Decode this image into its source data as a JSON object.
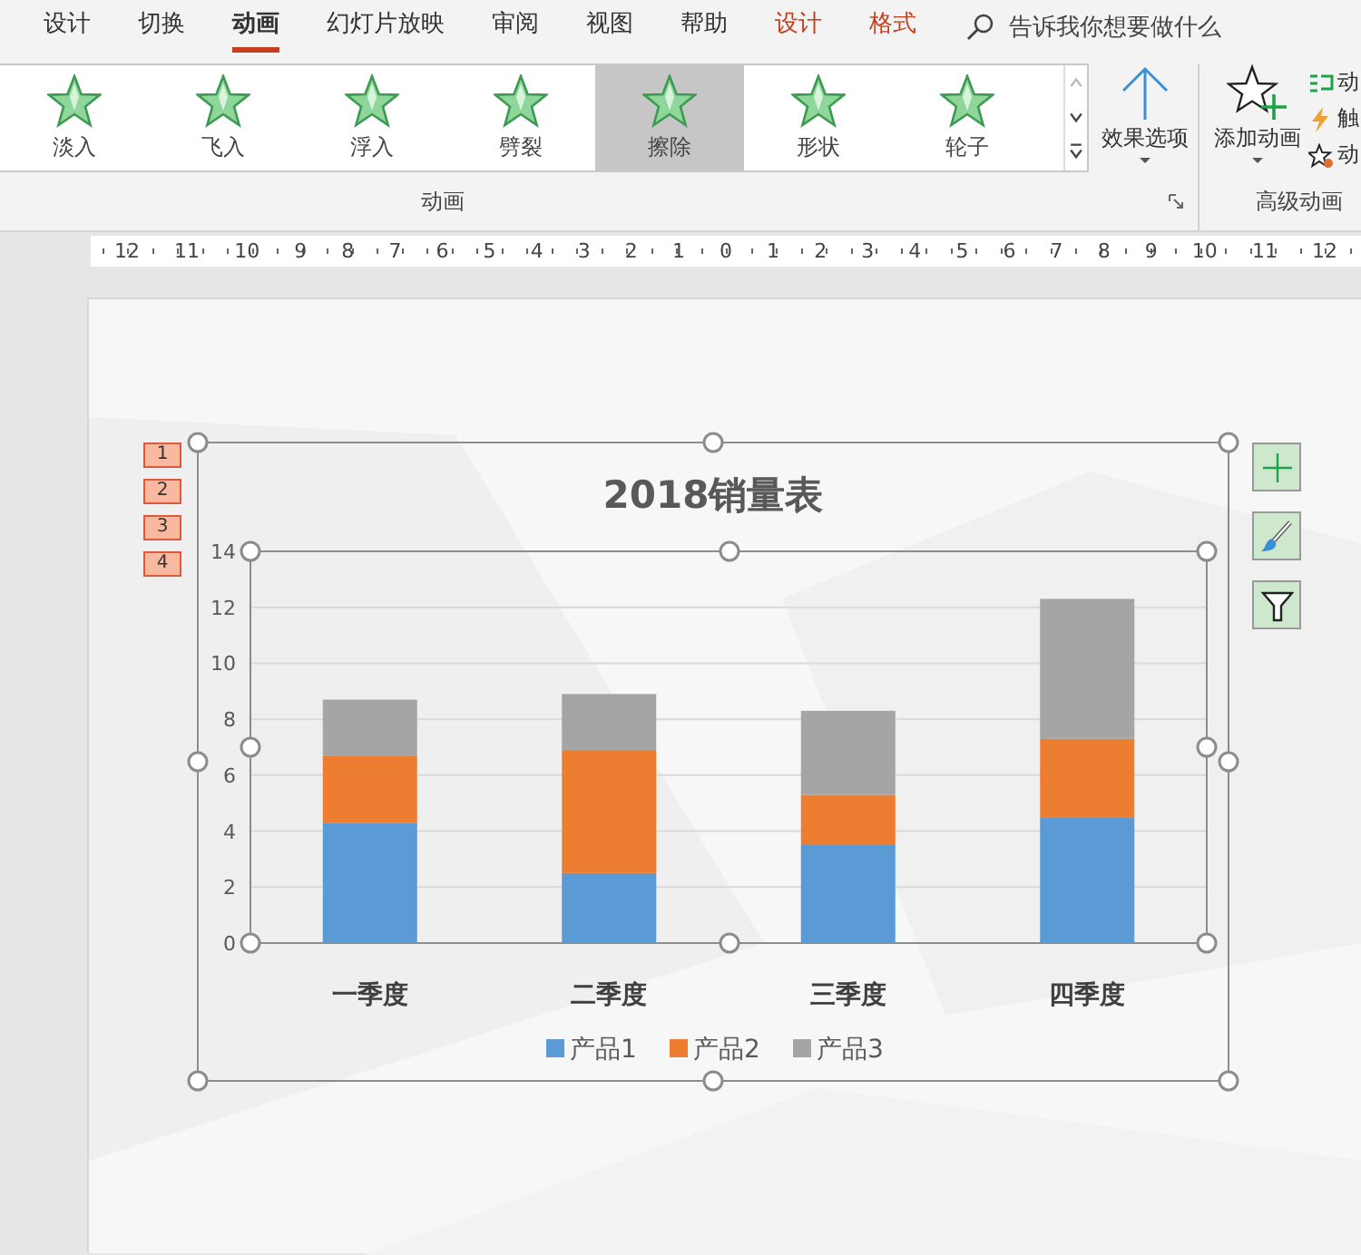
{
  "ribbon": {
    "tabs": [
      {
        "label": "设计",
        "selected": false,
        "kind": "standard"
      },
      {
        "label": "切换",
        "selected": false,
        "kind": "standard"
      },
      {
        "label": "动画",
        "selected": true,
        "kind": "standard"
      },
      {
        "label": "幻灯片放映",
        "selected": false,
        "kind": "standard"
      },
      {
        "label": "审阅",
        "selected": false,
        "kind": "standard"
      },
      {
        "label": "视图",
        "selected": false,
        "kind": "standard"
      },
      {
        "label": "帮助",
        "selected": false,
        "kind": "standard"
      },
      {
        "label": "设计",
        "selected": false,
        "kind": "contextual"
      },
      {
        "label": "格式",
        "selected": false,
        "kind": "contextual"
      }
    ],
    "search": {
      "placeholder": "告诉我你想要做什么"
    },
    "gallery": [
      {
        "label": "淡入",
        "selected": false
      },
      {
        "label": "飞入",
        "selected": false
      },
      {
        "label": "浮入",
        "selected": false
      },
      {
        "label": "劈裂",
        "selected": false
      },
      {
        "label": "擦除",
        "selected": true
      },
      {
        "label": "形状",
        "selected": false
      },
      {
        "label": "轮子",
        "selected": false
      }
    ],
    "effect_options": {
      "label": "效果选项"
    },
    "group_label": "动画",
    "add_animation": {
      "label": "添加动画"
    },
    "advanced_items": [
      "动",
      "触",
      "动"
    ],
    "advanced_group_label": "高级动画"
  },
  "ruler": "12 11 10 9 8 7 6 5 4 3 2 1 0 1 2 3 4 5 6 7 8 9 10 11 12",
  "slide": {
    "animation_tags": [
      "1",
      "2",
      "3",
      "4"
    ],
    "chart": {
      "chart_data": {
        "type": "bar",
        "title": "2018销量表",
        "categories": [
          "一季度",
          "二季度",
          "三季度",
          "四季度"
        ],
        "series": [
          {
            "name": "产品1",
            "color": "#5b9bd5",
            "values": [
              4.3,
              2.5,
              3.5,
              4.5
            ]
          },
          {
            "name": "产品2",
            "color": "#ed7d31",
            "values": [
              2.4,
              4.4,
              1.8,
              2.8
            ]
          },
          {
            "name": "产品3",
            "color": "#a5a5a5",
            "values": [
              2,
              2,
              3,
              5
            ]
          }
        ],
        "grid": true,
        "legend": "bottom",
        "ylim": [
          0,
          14
        ],
        "yticks": [
          0,
          2,
          4,
          6,
          8,
          10,
          12,
          14
        ],
        "stacked": true,
        "orientation": "vertical"
      }
    }
  }
}
